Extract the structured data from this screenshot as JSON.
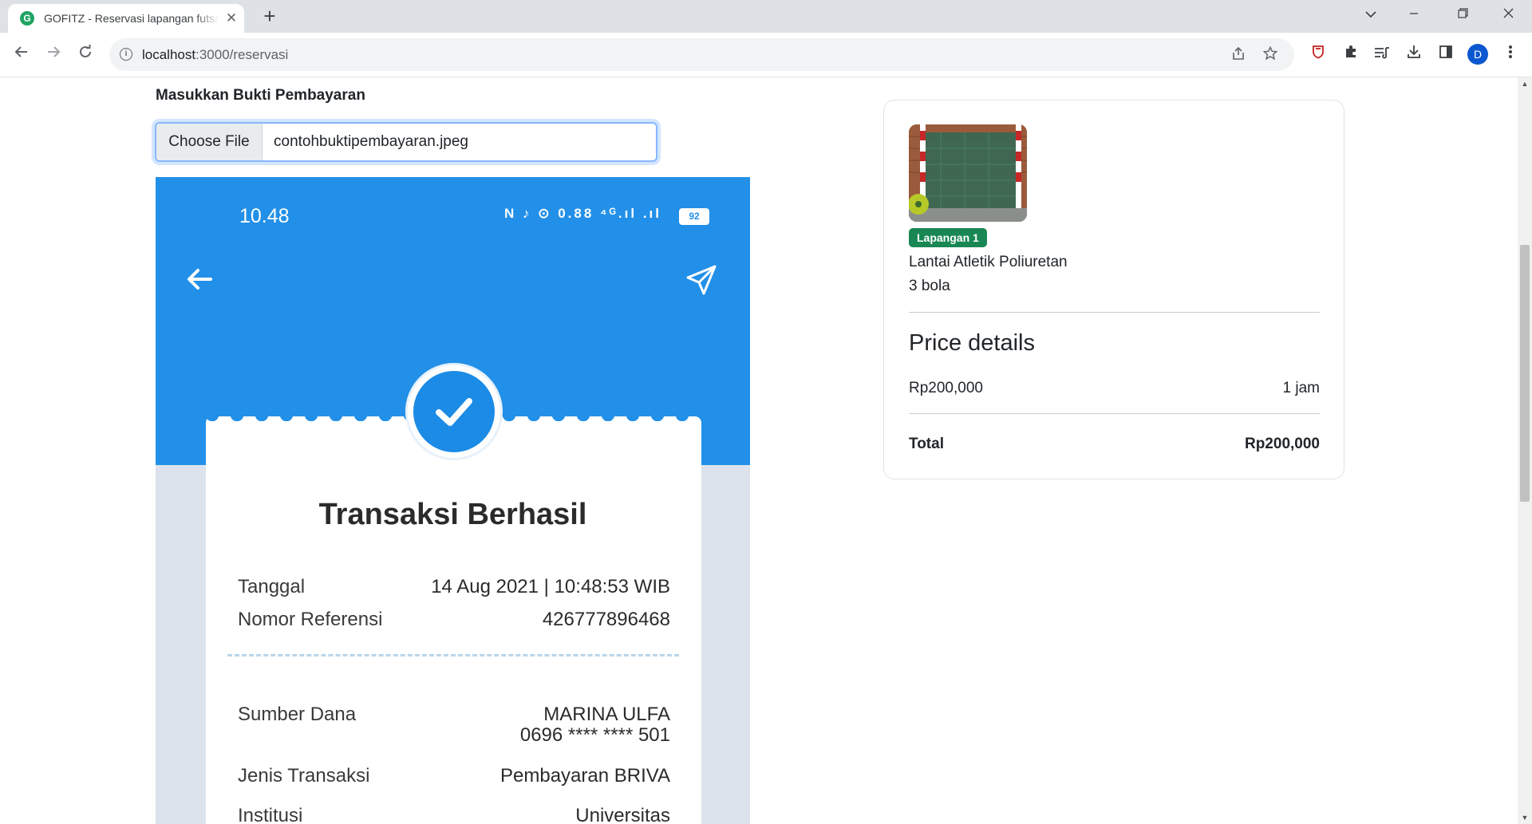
{
  "browser": {
    "tab_title": "GOFITZ - Reservasi lapangan futsal",
    "favicon_letter": "G",
    "tab_close": "✕",
    "new_tab": "+",
    "url_host": "localhost",
    "url_rest": ":3000/reservasi",
    "profile_initial": "D"
  },
  "upload": {
    "label": "Masukkan Bukti Pembayaran",
    "button": "Choose File",
    "file_name": "contohbuktipembayaran.jpeg"
  },
  "receipt": {
    "status_time": "10.48",
    "status_icons": "N ♪ ⊙ 0.88 ⁴ᴳ.ıl .ıl",
    "battery": "92",
    "title": "Transaksi Berhasil",
    "rows": [
      {
        "label": "Tanggal",
        "value": "14 Aug 2021 | 10:48:53 WIB"
      },
      {
        "label": "Nomor Referensi",
        "value": "426777896468"
      },
      {
        "label": "Sumber Dana",
        "value": "MARINA ULFA",
        "value2": "0696 **** **** 501"
      },
      {
        "label": "Jenis Transaksi",
        "value": "Pembayaran BRIVA"
      },
      {
        "label": "Institusi",
        "value": "Universitas"
      }
    ]
  },
  "field": {
    "badge": "Lapangan 1",
    "type": "Lantai Atletik Poliuretan",
    "balls": "3 bola"
  },
  "price": {
    "title": "Price details",
    "rate": "Rp200,000",
    "duration": "1 jam",
    "total_label": "Total",
    "total_value": "Rp200,000"
  },
  "colors": {
    "receipt_blue": "#2290e8",
    "badge_green": "#198754",
    "focus_border": "#86b7fe"
  }
}
